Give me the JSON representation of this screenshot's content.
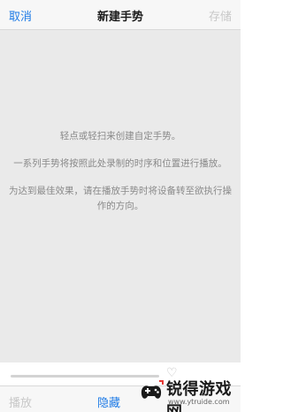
{
  "navbar": {
    "cancel_label": "取消",
    "title": "新建手势",
    "save_label": "存储"
  },
  "canvas": {
    "instructions": [
      "轻点或轻扫来创建自定手势。",
      "一系列手势将按照此处录制的时序和位置进行播放。",
      "为达到最佳效果，请在播放手势时将设备转至欲执行操作的方向。"
    ]
  },
  "toolbar": {
    "play_label": "播放",
    "hide_label": "隐藏"
  },
  "watermark": {
    "name": "锐得游戏网",
    "url": "www.ytruide.com"
  },
  "colors": {
    "accent": "#1e7be6",
    "disabled": "#c8c8c8",
    "canvas_bg": "#eaeaea"
  },
  "icons": {
    "heart": "heart-outline-icon"
  }
}
